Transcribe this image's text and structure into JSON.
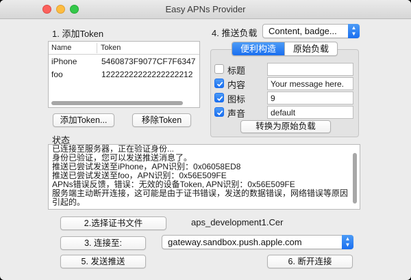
{
  "window": {
    "title": "Easy APNs Provider"
  },
  "tokens": {
    "section_label": "1. 添加Token",
    "columns": {
      "name": "Name",
      "token": "Token"
    },
    "rows": [
      {
        "name": "iPhone",
        "token": "5460873F9077CF7F6347"
      },
      {
        "name": "foo",
        "token": "12222222222222222212"
      }
    ],
    "add_button": "添加Token...",
    "remove_button": "移除Token"
  },
  "payload": {
    "section_label": "4. 推送负载",
    "type_value": "Content, badge...",
    "tabs": [
      {
        "label": "便利构造",
        "selected": true
      },
      {
        "label": "原始负载",
        "selected": false
      }
    ],
    "fields": [
      {
        "label": "标题",
        "checked": false,
        "value": ""
      },
      {
        "label": "内容",
        "checked": true,
        "value": "Your message here."
      },
      {
        "label": "图标",
        "checked": true,
        "value": "9"
      },
      {
        "label": "声音",
        "checked": true,
        "value": "default"
      }
    ],
    "convert_button": "转换为原始负载"
  },
  "status": {
    "section_label": "状态",
    "lines": [
      "已连接至服务器，正在验证身份...",
      "身份已验证，您可以发送推送消息了。",
      "推送已尝试发送至iPhone，APN识别：0x06058ED8",
      "推送已尝试发送至foo，APN识别：0x56E509FE",
      "APNs错误反馈，错误：无效的设备Token, APN识别：0x56E509FE",
      "服务端主动断开连接，这可能是由于证书错误，发送的数据错误，网络错误等原因引起的。"
    ]
  },
  "actions": {
    "select_cert_button": "2.选择证书文件",
    "cert_filename": "aps_development1.Cer",
    "connect_button": "3. 连接至:",
    "server_value": "gateway.sandbox.push.apple.com",
    "send_button": "5. 发送推送",
    "disconnect_button": "6. 断开连接"
  },
  "colors": {
    "accent": "#1a6ff0",
    "window_bg": "#ececec"
  }
}
